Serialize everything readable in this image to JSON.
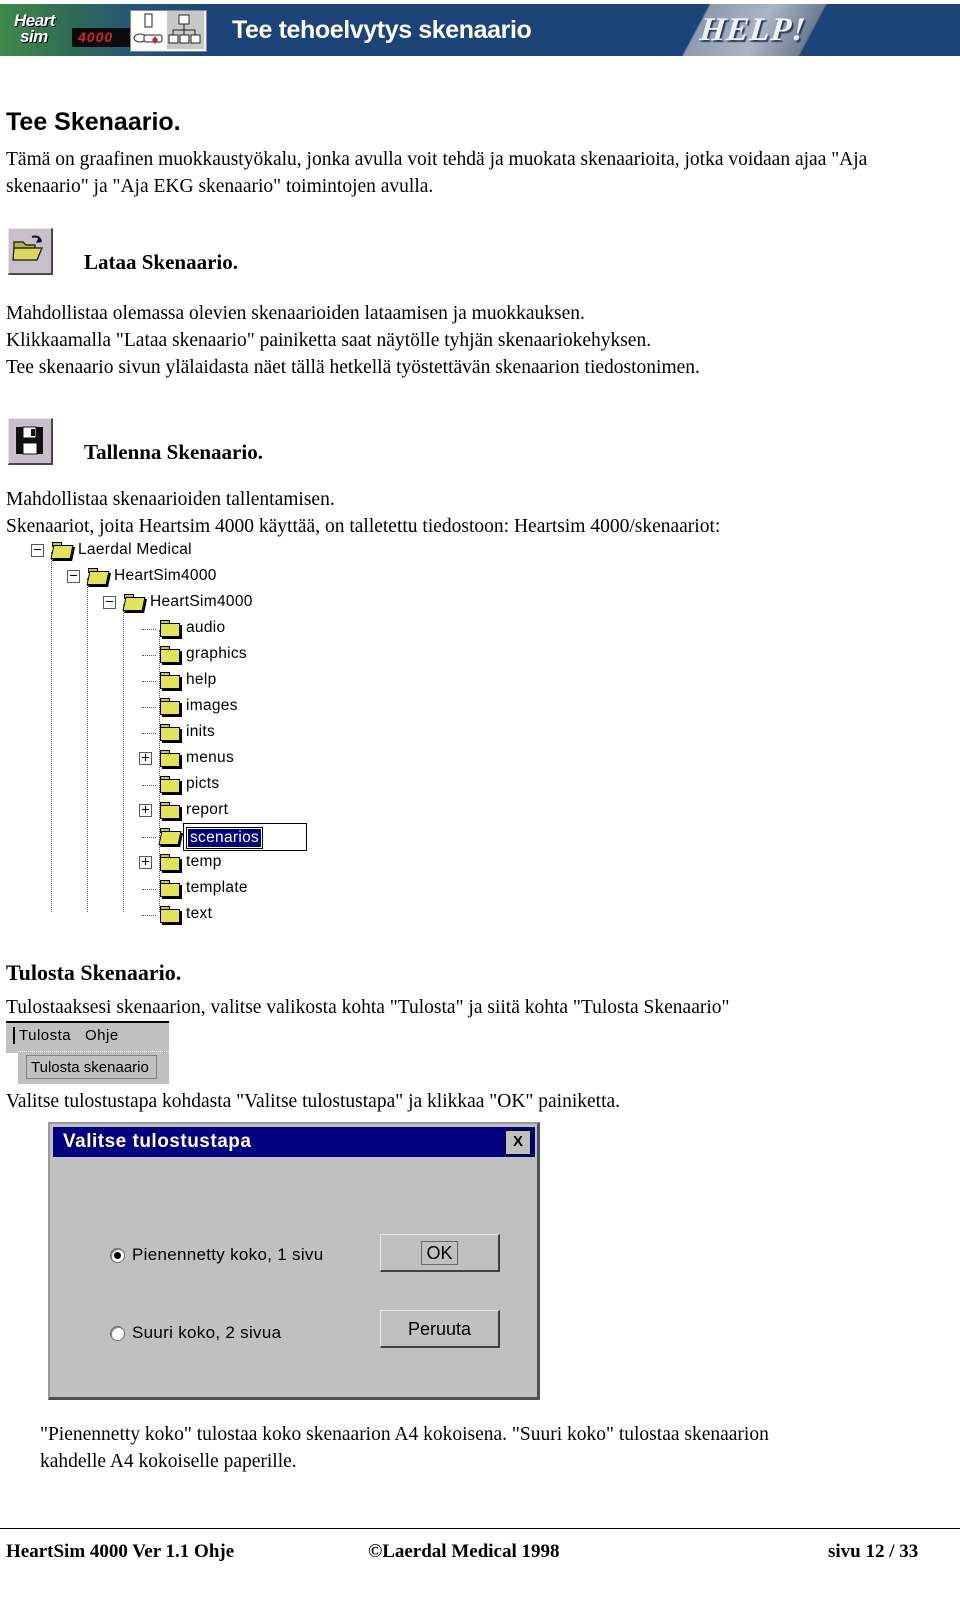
{
  "banner": {
    "logo_heart": "Heart",
    "logo_sim": "sim",
    "logo_model": "4000",
    "title": "Tee tehoelvytys skenaario",
    "help": "HELP!",
    "icon_plate_name": "manikin-and-network-icon",
    "colors": {
      "banner_blue": "#1d4478",
      "banner_green": "#3f8a4a",
      "logo_red": "#d4232a"
    }
  },
  "page": {
    "heading": "Tee Skenaario.",
    "intro": "Tämä on graafinen muokkaustyökalu, jonka avulla voit tehdä ja muokata skenaarioita, jotka voidaan ajaa \"Aja skenaario\" ja \"Aja EKG skenaario\" toimintojen avulla."
  },
  "load_section": {
    "icon": "open-folder-icon",
    "heading": "Lataa Skenaario.",
    "line1": "Mahdollistaa olemassa olevien skenaarioiden lataamisen ja muokkauksen.",
    "line2": "Klikkaamalla \"Lataa skenaario\" painiketta saat näytölle tyhjän skenaariokehyksen.",
    "line3": "Tee skenaario sivun ylälaidasta näet tällä hetkellä työstettävän skenaarion tiedostonimen."
  },
  "save_section": {
    "icon": "floppy-disk-icon",
    "heading": "Tallenna Skenaario.",
    "line1": "Mahdollistaa skenaarioiden tallentamisen.",
    "line2": "Skenaariot, joita Heartsim 4000 käyttää, on talletettu tiedostoon: Heartsim 4000/skenaariot:"
  },
  "tree": {
    "nodes": [
      {
        "label": "Laerdal Medical",
        "depth": 0,
        "toggle": "minus",
        "selected": false
      },
      {
        "label": "HeartSim4000",
        "depth": 1,
        "toggle": "minus",
        "selected": false
      },
      {
        "label": "HeartSim4000",
        "depth": 2,
        "toggle": "minus",
        "selected": false
      },
      {
        "label": "audio",
        "depth": 3,
        "toggle": "none",
        "selected": false
      },
      {
        "label": "graphics",
        "depth": 3,
        "toggle": "none",
        "selected": false
      },
      {
        "label": "help",
        "depth": 3,
        "toggle": "none",
        "selected": false
      },
      {
        "label": "images",
        "depth": 3,
        "toggle": "none",
        "selected": false
      },
      {
        "label": "inits",
        "depth": 3,
        "toggle": "none",
        "selected": false
      },
      {
        "label": "menus",
        "depth": 3,
        "toggle": "plus",
        "selected": false
      },
      {
        "label": "picts",
        "depth": 3,
        "toggle": "none",
        "selected": false
      },
      {
        "label": "report",
        "depth": 3,
        "toggle": "plus",
        "selected": false
      },
      {
        "label": "scenarios",
        "depth": 3,
        "toggle": "none",
        "selected": true
      },
      {
        "label": "temp",
        "depth": 3,
        "toggle": "plus",
        "selected": false
      },
      {
        "label": "template",
        "depth": 3,
        "toggle": "none",
        "selected": false
      },
      {
        "label": "text",
        "depth": 3,
        "toggle": "none",
        "selected": false
      }
    ]
  },
  "print_section": {
    "heading": "Tulosta Skenaario.",
    "line1": "Tulostaaksesi skenaarion, valitse valikosta kohta \"Tulosta\" ja siitä kohta \"Tulosta Skenaario\"",
    "menu": {
      "items": [
        "Tulosta",
        "Ohje"
      ],
      "dropdown_item": "Tulosta skenaario"
    },
    "line2": "Valitse tulostustapa kohdasta \"Valitse tulostustapa\" ja klikkaa \"OK\" painiketta."
  },
  "dialog": {
    "title": "Valitse tulostustapa",
    "close_label": "×",
    "close_glyph": "X",
    "radios": [
      {
        "label": "Pienennetty koko, 1 sivu",
        "selected": true
      },
      {
        "label": "Suuri koko, 2 sivua",
        "selected": false
      }
    ],
    "buttons": [
      {
        "label": "OK",
        "focused": true
      },
      {
        "label": "Peruuta",
        "focused": false
      }
    ],
    "title_color": "#000080",
    "face_color": "#c0c0c0"
  },
  "closing": {
    "line1": "\"Pienennetty koko\" tulostaa koko skenaarion A4 kokoisena. \"Suuri koko\" tulostaa skenaarion",
    "line2": "kahdelle A4 kokoiselle paperille."
  },
  "footer": {
    "left": "HeartSim 4000 Ver 1.1 Ohje",
    "center": "©Laerdal Medical 1998",
    "right": "sivu 12 / 33"
  }
}
